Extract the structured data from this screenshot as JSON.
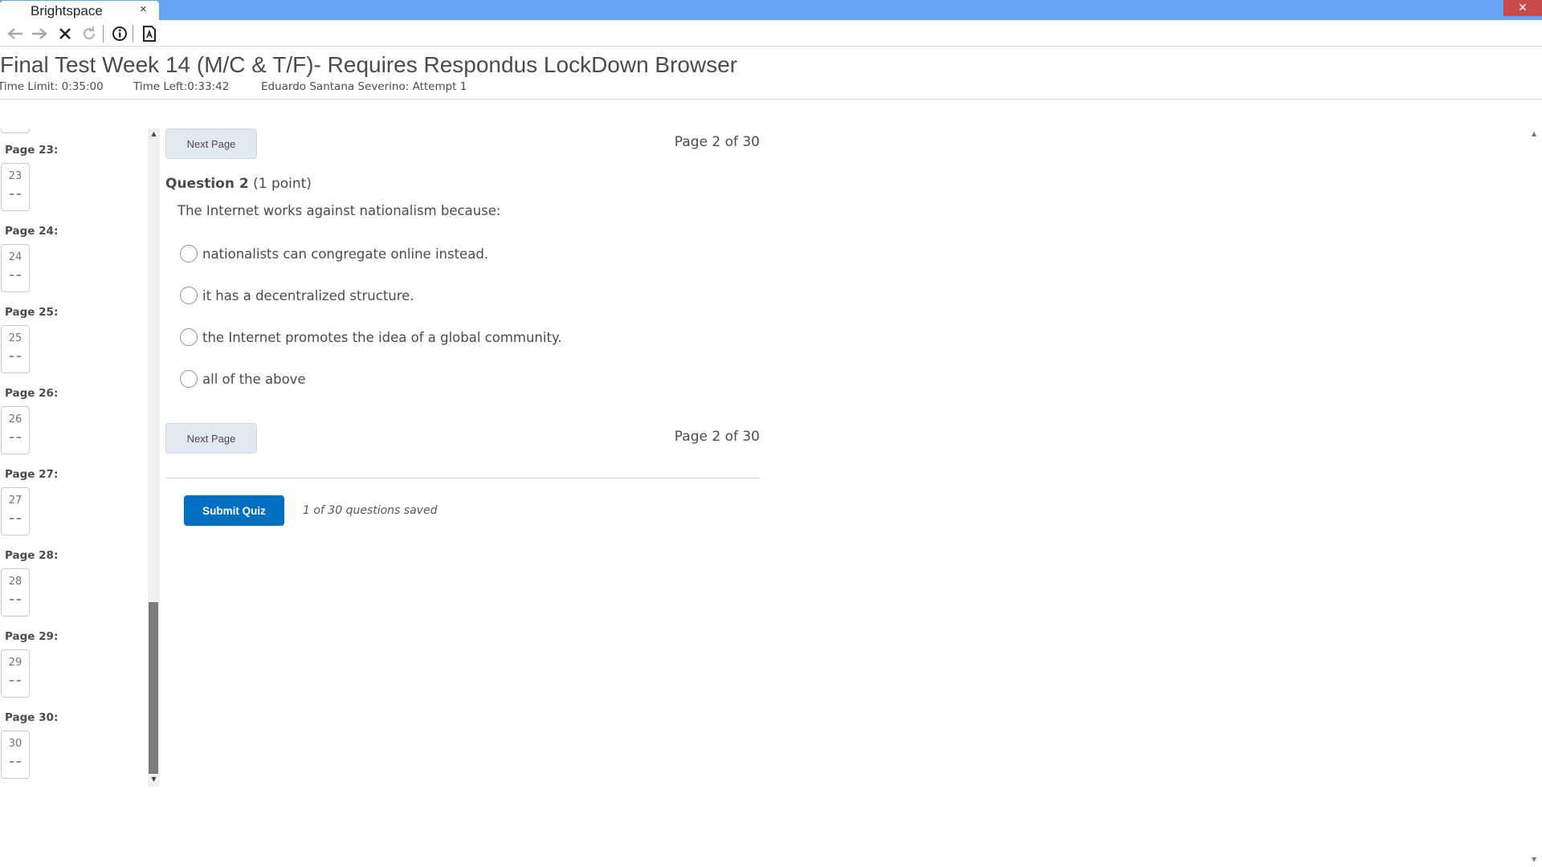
{
  "browser": {
    "tab_title": "Brightspace",
    "tab_close": "×",
    "window_close": "✕"
  },
  "quiz": {
    "title": "Final Test Week 14 (M/C & T/F)- Requires Respondus LockDown Browser",
    "time_limit": "Time Limit: 0:35:00",
    "time_left": "Time Left:0:33:42",
    "attempt": "Eduardo Santana Severino: Attempt 1"
  },
  "sidebar": {
    "pages": [
      {
        "label": "Page 23:",
        "number": "23"
      },
      {
        "label": "Page 24:",
        "number": "24"
      },
      {
        "label": "Page 25:",
        "number": "25"
      },
      {
        "label": "Page 26:",
        "number": "26"
      },
      {
        "label": "Page 27:",
        "number": "27"
      },
      {
        "label": "Page 28:",
        "number": "28"
      },
      {
        "label": "Page 29:",
        "number": "29"
      },
      {
        "label": "Page 30:",
        "number": "30"
      }
    ]
  },
  "nav": {
    "next_label": "Next Page",
    "page_indicator": "Page 2 of 30"
  },
  "question": {
    "number_label": "Question 2",
    "points": "(1 point)",
    "text": "The Internet works against nationalism because:",
    "options": [
      "nationalists can congregate online instead.",
      "it has a decentralized structure.",
      "the Internet promotes the idea of a global community.",
      "all of the above"
    ]
  },
  "footer": {
    "submit_label": "Submit Quiz",
    "saved_status": "1 of 30 questions saved"
  },
  "colors": {
    "tabstrip": "#64a4f0",
    "submit": "#006fbf",
    "window_close": "#c94a4a"
  }
}
